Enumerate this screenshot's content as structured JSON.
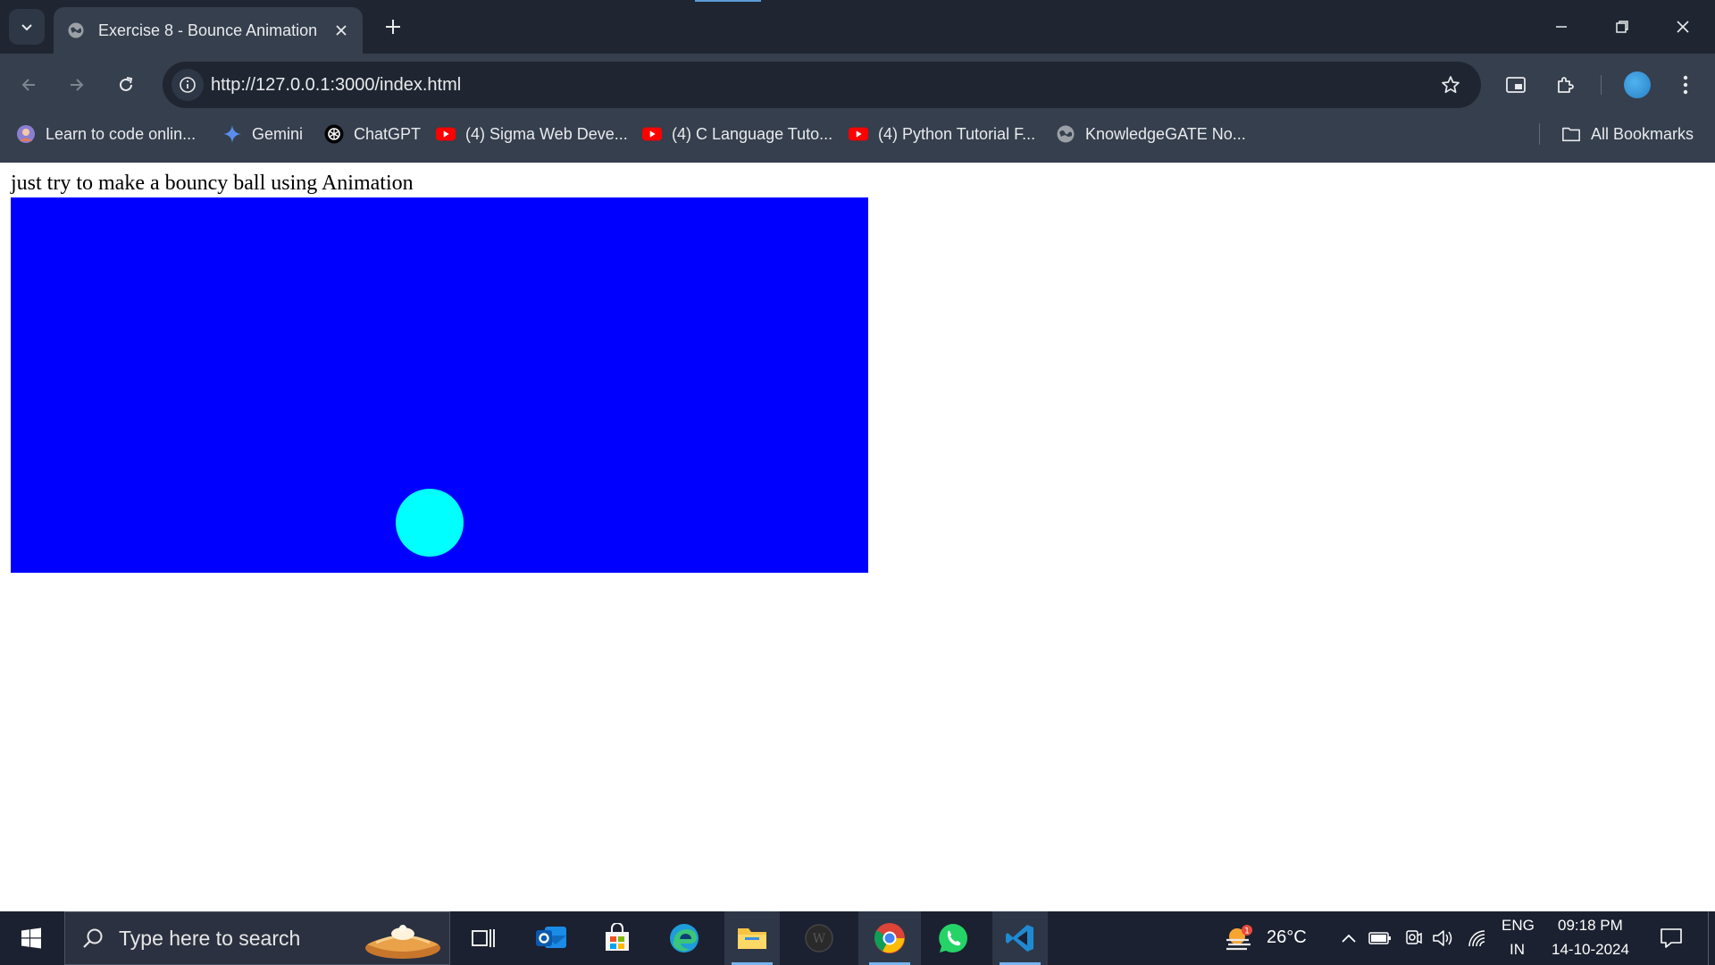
{
  "browser": {
    "tab": {
      "title": "Exercise 8 - Bounce Animation",
      "favicon": "globe-icon"
    },
    "address": {
      "url": "http://127.0.0.1:3000/index.html"
    },
    "bookmarks": [
      {
        "label": "Learn to code onlin...",
        "icon": "avatar-icon"
      },
      {
        "label": "Gemini",
        "icon": "gemini-sparkle-icon"
      },
      {
        "label": "ChatGPT",
        "icon": "chatgpt-icon"
      },
      {
        "label": "(4) Sigma Web Deve...",
        "icon": "youtube-icon"
      },
      {
        "label": "(4) C Language Tuto...",
        "icon": "youtube-icon"
      },
      {
        "label": "(4) Python Tutorial F...",
        "icon": "youtube-icon"
      },
      {
        "label": "KnowledgeGATE No...",
        "icon": "globe-icon"
      }
    ],
    "all_bookmarks": "All Bookmarks"
  },
  "page": {
    "text": "just try to make a bouncy ball using Animation",
    "stage_color": "#0000ff",
    "ball_color": "#00ffff"
  },
  "taskbar": {
    "search_placeholder": "Type here to search",
    "weather": {
      "temp": "26°C",
      "badge": "1"
    },
    "language": {
      "line1": "ENG",
      "line2": "IN"
    },
    "clock": {
      "time": "09:18 PM",
      "date": "14-10-2024"
    }
  },
  "colors": {
    "tabstrip": "#1f2631",
    "toolbar": "#353f4d",
    "taskbar": "#1b2130",
    "accent": "#5b9bd5"
  }
}
